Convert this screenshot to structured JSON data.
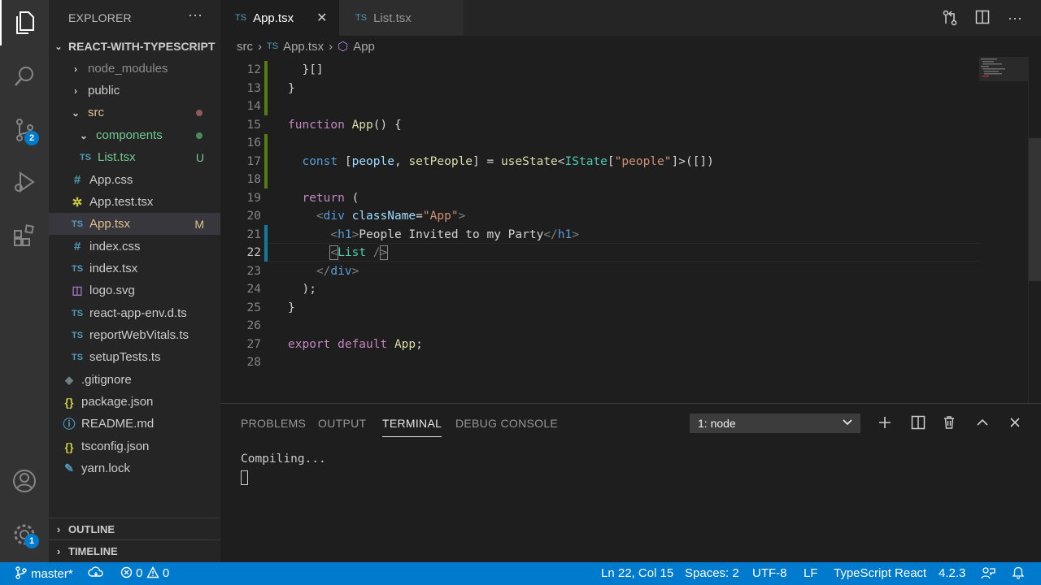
{
  "sidebar": {
    "title": "EXPLORER",
    "more": "···",
    "project": "REACT-WITH-TYPESCRIPT",
    "items": [
      {
        "label": "node_modules",
        "kind": "folder",
        "state": "collapsed"
      },
      {
        "label": "public",
        "kind": "folder",
        "state": "collapsed"
      },
      {
        "label": "src",
        "kind": "folder",
        "state": "expanded"
      },
      {
        "label": "components",
        "kind": "folder",
        "state": "expanded"
      },
      {
        "label": "List.tsx",
        "kind": "ts",
        "mark": "U"
      },
      {
        "label": "App.css",
        "kind": "css"
      },
      {
        "label": "App.test.tsx",
        "kind": "test"
      },
      {
        "label": "App.tsx",
        "kind": "ts",
        "mark": "M"
      },
      {
        "label": "index.css",
        "kind": "css"
      },
      {
        "label": "index.tsx",
        "kind": "ts"
      },
      {
        "label": "logo.svg",
        "kind": "svg"
      },
      {
        "label": "react-app-env.d.ts",
        "kind": "ts"
      },
      {
        "label": "reportWebVitals.ts",
        "kind": "ts"
      },
      {
        "label": "setupTests.ts",
        "kind": "ts"
      },
      {
        "label": ".gitignore",
        "kind": "git"
      },
      {
        "label": "package.json",
        "kind": "json"
      },
      {
        "label": "README.md",
        "kind": "info"
      },
      {
        "label": "tsconfig.json",
        "kind": "json"
      },
      {
        "label": "yarn.lock",
        "kind": "yarn"
      }
    ],
    "outline": "OUTLINE",
    "timeline": "TIMELINE"
  },
  "activity": {
    "scm_badge": "2",
    "settings_badge": "1"
  },
  "tabs": [
    {
      "prefix": "TS",
      "label": "App.tsx",
      "close": "✕"
    },
    {
      "prefix": "TS",
      "label": "List.tsx"
    }
  ],
  "breadcrumb": {
    "folder": "src",
    "prefix": "TS",
    "file": "App.tsx",
    "symbol": "App"
  },
  "editor": {
    "line_numbers": [
      "12",
      "13",
      "14",
      "15",
      "16",
      "17",
      "18",
      "19",
      "20",
      "21",
      "22",
      "23",
      "24",
      "25",
      "26",
      "27",
      "28"
    ],
    "current_line": "22"
  },
  "panel": {
    "tabs": [
      "PROBLEMS",
      "OUTPUT",
      "TERMINAL",
      "DEBUG CONSOLE"
    ],
    "terminal_select": "1: node",
    "terminal_output": "Compiling..."
  },
  "status": {
    "branch": "master*",
    "errors": "0",
    "warnings": "0",
    "position": "Ln 22, Col 15",
    "spaces": "Spaces: 2",
    "encoding": "UTF-8",
    "eol": "LF",
    "language": "TypeScript React",
    "version": "4.2.3"
  },
  "colors": {
    "accent": "#007acc",
    "modified": "#e2c08d",
    "untracked": "#73c991"
  }
}
